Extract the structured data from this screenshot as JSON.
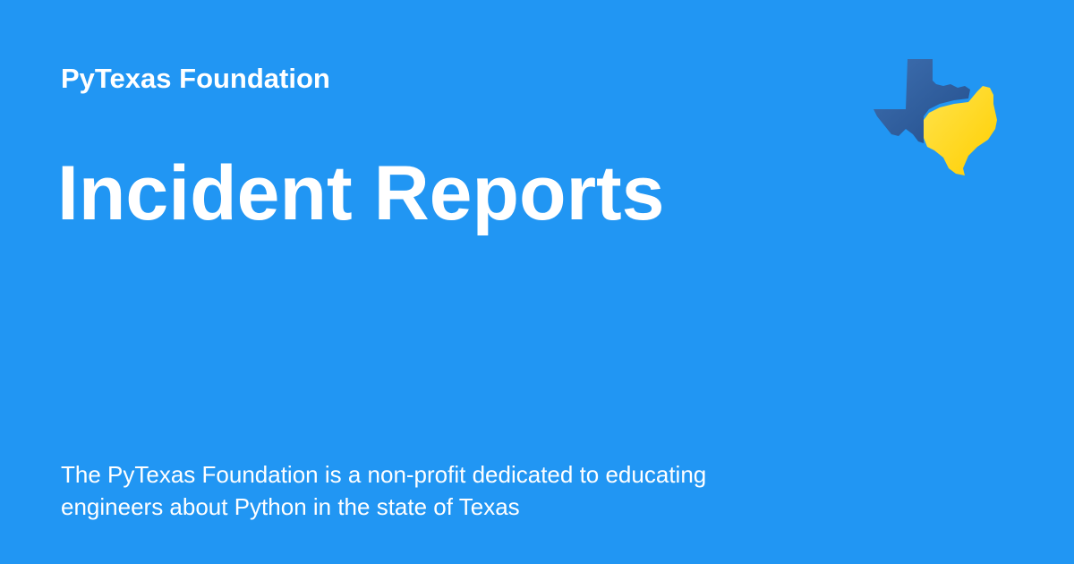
{
  "card": {
    "site_name": "PyTexas Foundation",
    "title": "Incident Reports",
    "description": "The PyTexas Foundation is a non-profit dedicated to educating engineers about Python in the state of Texas"
  },
  "logo": {
    "icon": "pytexas-logo-icon",
    "colors": {
      "blue": "#2b5b9b",
      "yellow": "#ffd600"
    }
  },
  "colors": {
    "background": "#2196f3",
    "text": "#ffffff"
  }
}
